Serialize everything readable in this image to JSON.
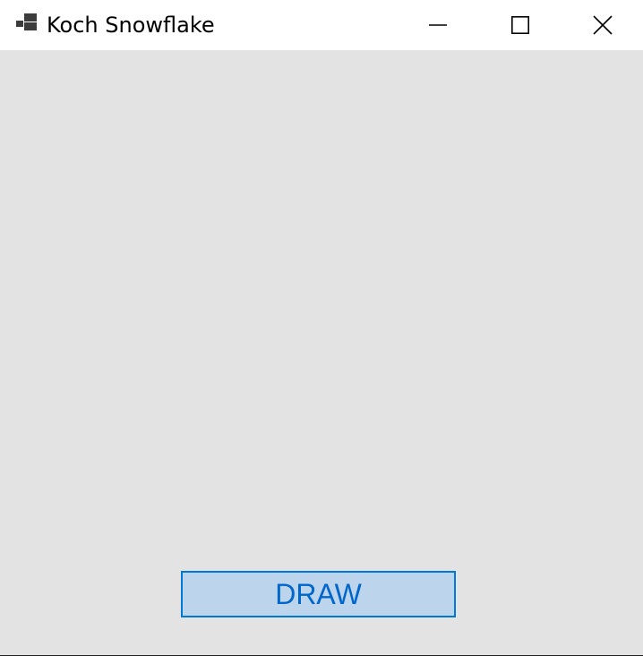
{
  "window": {
    "title": "Koch Snowflake",
    "app_icon": "application-icon",
    "controls": {
      "minimize_icon": "minimize-icon",
      "maximize_icon": "maximize-icon",
      "close_icon": "close-icon"
    }
  },
  "main": {
    "draw_label": "DRAW"
  },
  "colors": {
    "titlebar": "#ffffff",
    "client_background": "#e3e3e3",
    "button_fill": "#bcd4ec",
    "button_border": "#0078d7",
    "button_text": "#0066cc"
  }
}
